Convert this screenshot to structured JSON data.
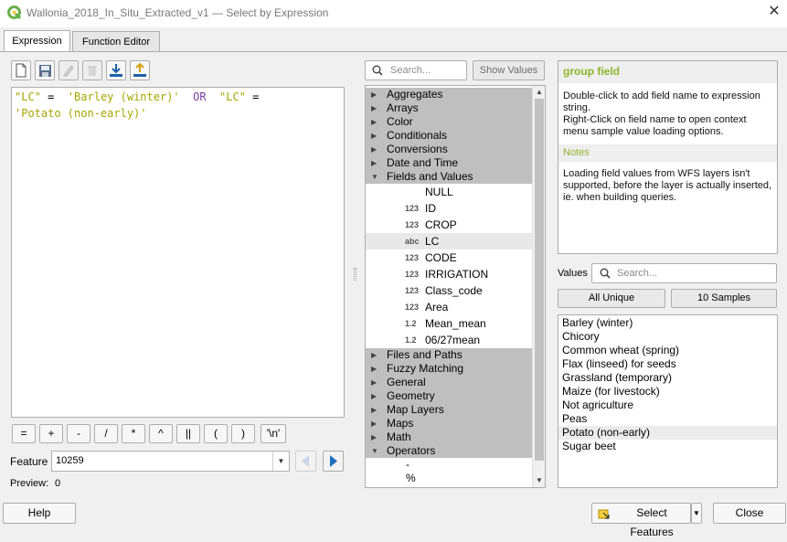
{
  "window": {
    "title": "Wallonia_2018_In_Situ_Extracted_v1 — Select by Expression",
    "close_glyph": "✕"
  },
  "tabs": [
    {
      "label": "Expression",
      "active": true
    },
    {
      "label": "Function Editor",
      "active": false
    }
  ],
  "toolbar": {
    "icons": [
      "new-file-icon",
      "save-icon",
      "edit-icon",
      "delete-icon",
      "import-icon",
      "export-icon"
    ]
  },
  "expression": {
    "line1": [
      {
        "t": "\"LC\"",
        "k": "str"
      },
      {
        "t": " = ",
        "k": "plain"
      },
      {
        "t": " 'Barley (winter)' ",
        "k": "str"
      },
      {
        "t": " OR ",
        "k": "op"
      },
      {
        "t": " \"LC\"",
        "k": "str"
      },
      {
        "t": " =",
        "k": "plain"
      }
    ],
    "line2": [
      {
        "t": "'Potato (non-early)'",
        "k": "str"
      }
    ]
  },
  "operators": [
    "=",
    "+",
    "-",
    "/",
    "*",
    "^",
    "||",
    "(",
    ")",
    "'\\n'"
  ],
  "feature": {
    "label": "Feature",
    "value": "10259"
  },
  "preview": {
    "label": "Preview:",
    "value": "0"
  },
  "search": {
    "placeholder": "Search...",
    "show_values_label": "Show Values"
  },
  "tree": {
    "groups_top": [
      {
        "label": "Aggregates",
        "expanded": false
      },
      {
        "label": "Arrays",
        "expanded": false
      },
      {
        "label": "Color",
        "expanded": false
      },
      {
        "label": "Conditionals",
        "expanded": false
      },
      {
        "label": "Conversions",
        "expanded": false
      },
      {
        "label": "Date and Time",
        "expanded": false
      },
      {
        "label": "Fields and Values",
        "expanded": true
      }
    ],
    "fields": [
      {
        "type": "",
        "label": "NULL"
      },
      {
        "type": "123",
        "label": "ID"
      },
      {
        "type": "123",
        "label": "CROP"
      },
      {
        "type": "abc",
        "label": "LC",
        "selected": true
      },
      {
        "type": "123",
        "label": "CODE"
      },
      {
        "type": "123",
        "label": "IRRIGATION"
      },
      {
        "type": "123",
        "label": "Class_code"
      },
      {
        "type": "123",
        "label": "Area"
      },
      {
        "type": "1.2",
        "label": "Mean_mean"
      },
      {
        "type": "1.2",
        "label": "06/27mean"
      }
    ],
    "groups_bottom": [
      {
        "label": "Files and Paths",
        "expanded": false
      },
      {
        "label": "Fuzzy Matching",
        "expanded": false
      },
      {
        "label": "General",
        "expanded": false
      },
      {
        "label": "Geometry",
        "expanded": false
      },
      {
        "label": "Map Layers",
        "expanded": false
      },
      {
        "label": "Maps",
        "expanded": false
      },
      {
        "label": "Math",
        "expanded": false
      },
      {
        "label": "Operators",
        "expanded": true
      }
    ],
    "operator_children": [
      "-",
      "%",
      "*"
    ]
  },
  "help": {
    "heading": "group field",
    "line1": "Double-click to add field name to expression string.",
    "line2": "Right-Click on field name to open context menu sample value loading options.",
    "notes_heading": "Notes",
    "notes_text": "Loading field values from WFS layers isn't supported, before the layer is actually inserted, ie. when building queries."
  },
  "values": {
    "label": "Values",
    "search_placeholder": "Search...",
    "all_unique_label": "All Unique",
    "samples_label": "10 Samples",
    "items": [
      "Barley (winter)",
      "Chicory",
      "Common wheat (spring)",
      "Flax (linseed) for seeds",
      "Grassland (temporary)",
      "Maize (for livestock)",
      "Not agriculture",
      "Peas",
      "Potato (non-early)",
      "Sugar beet"
    ],
    "selected": "Potato (non-early)"
  },
  "footer": {
    "help_label": "Help",
    "select_features_label": "Select Features",
    "close_label": "Close"
  },
  "colors": {
    "accent_green": "#8db42b",
    "play_blue": "#1e6fc0",
    "tree_group_bg": "#bfbfbf"
  }
}
